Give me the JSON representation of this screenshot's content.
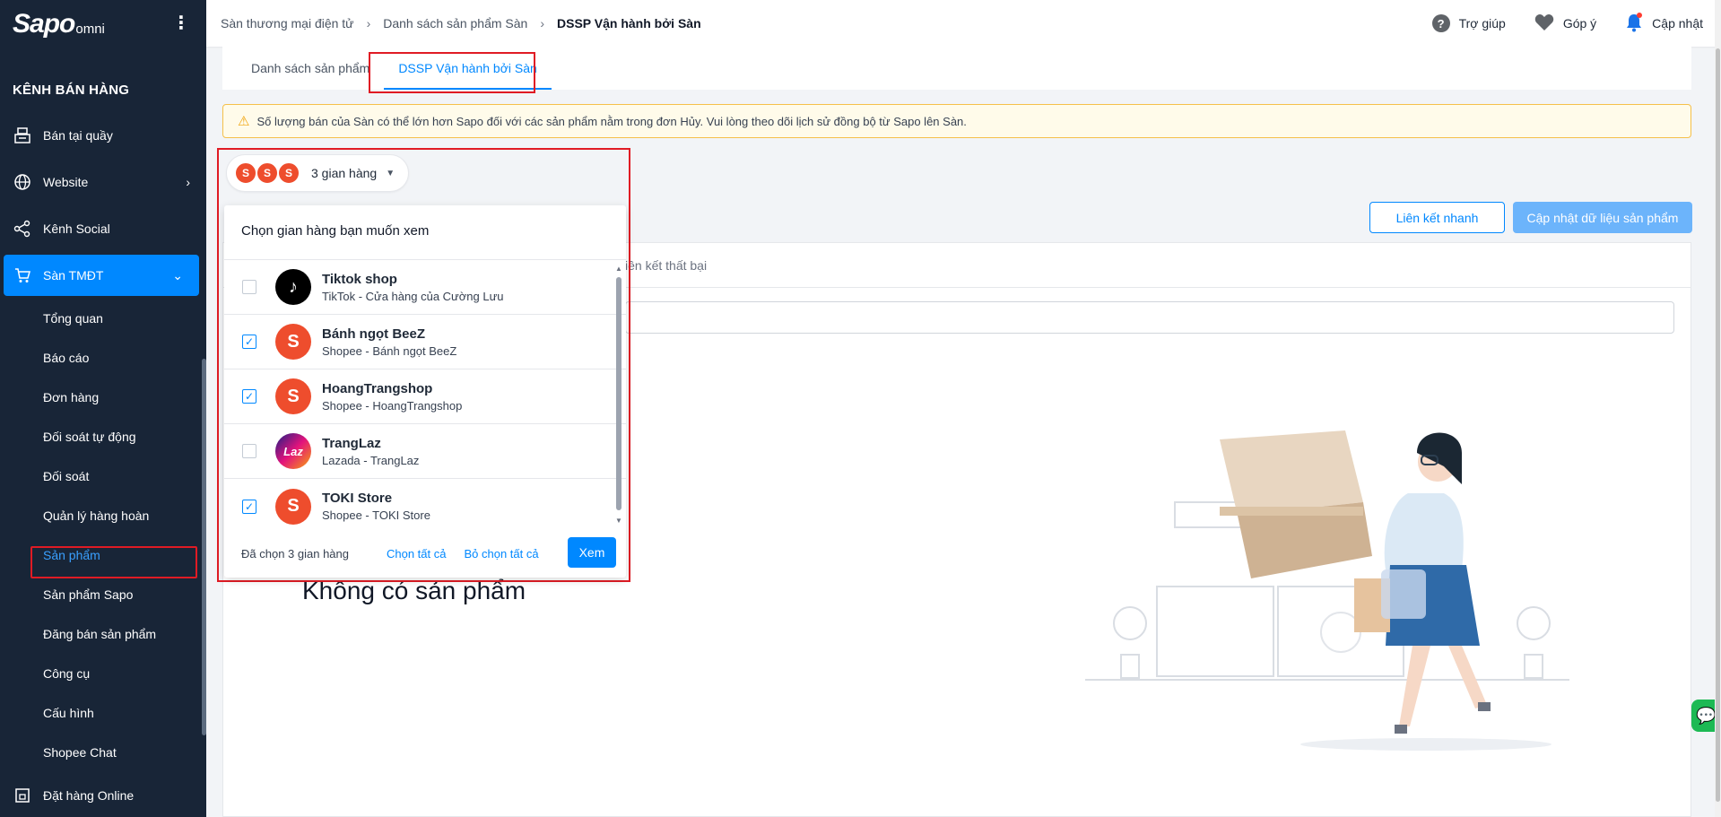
{
  "sidebar": {
    "brand": "Sapo",
    "brand_suffix": "omni",
    "section_title": "KÊNH BÁN HÀNG",
    "items": [
      {
        "label": "Bán tại quầy",
        "icon": "pos-icon"
      },
      {
        "label": "Website",
        "icon": "globe-icon"
      },
      {
        "label": "Kênh Social",
        "icon": "share-icon"
      },
      {
        "label": "Sàn TMĐT",
        "icon": "cart-icon"
      }
    ],
    "sub_items": [
      "Tổng quan",
      "Báo cáo",
      "Đơn hàng",
      "Đối soát tự động",
      "Đối soát",
      "Quản lý hàng hoàn",
      "Sản phẩm",
      "Sản phẩm Sapo",
      "Đăng bán sản phẩm",
      "Công cụ",
      "Cấu hình",
      "Shopee Chat"
    ],
    "bottom_item": "Đặt hàng Online"
  },
  "breadcrumb": [
    "Sàn thương mại điện tử",
    "Danh sách sản phẩm Sàn",
    "DSSP Vận hành bởi Sàn"
  ],
  "topbar": {
    "help": "Trợ giúp",
    "feedback": "Góp ý",
    "update": "Cập nhật"
  },
  "tabs": [
    "Danh sách sản phẩm",
    "DSSP Vận hành bởi Sàn"
  ],
  "warning": "Số lượng bán của Sàn có thể lớn hơn Sapo đối với các sản phẩm nằm trong đơn Hủy. Vui lòng theo dõi lịch sử đồng bộ từ Sapo lên Sàn.",
  "buttons": {
    "quick_link": "Liên kết nhanh",
    "update_data": "Cập nhật dữ liệu sản phẩm"
  },
  "panel": {
    "partial_tab": "iên kết thất bại",
    "empty": "Không có sản phẩm"
  },
  "selector": {
    "chip_label": "3 gian hàng",
    "title": "Chọn gian hàng bạn muốn xem",
    "stores": [
      {
        "name": "Tiktok shop",
        "sub": "TikTok - Cửa hàng của Cường Lưu",
        "checked": false,
        "type": "tiktok"
      },
      {
        "name": "Bánh ngọt BeeZ",
        "sub": "Shopee - Bánh ngọt BeeZ",
        "checked": true,
        "type": "shopee"
      },
      {
        "name": "HoangTrangshop",
        "sub": "Shopee - HoangTrangshop",
        "checked": true,
        "type": "shopee"
      },
      {
        "name": "TrangLaz",
        "sub": "Lazada - TrangLaz",
        "checked": false,
        "type": "lazada"
      },
      {
        "name": "TOKI Store",
        "sub": "Shopee - TOKI Store",
        "checked": true,
        "type": "shopee"
      }
    ],
    "selected_count": "Đã chọn 3 gian hàng",
    "select_all": "Chọn tất cả",
    "deselect_all": "Bỏ chọn tất cả",
    "view": "Xem"
  },
  "colors": {
    "primary": "#0088ff",
    "sidebar": "#182537",
    "shopee": "#ee4d2d",
    "highlight": "#e01b24"
  }
}
